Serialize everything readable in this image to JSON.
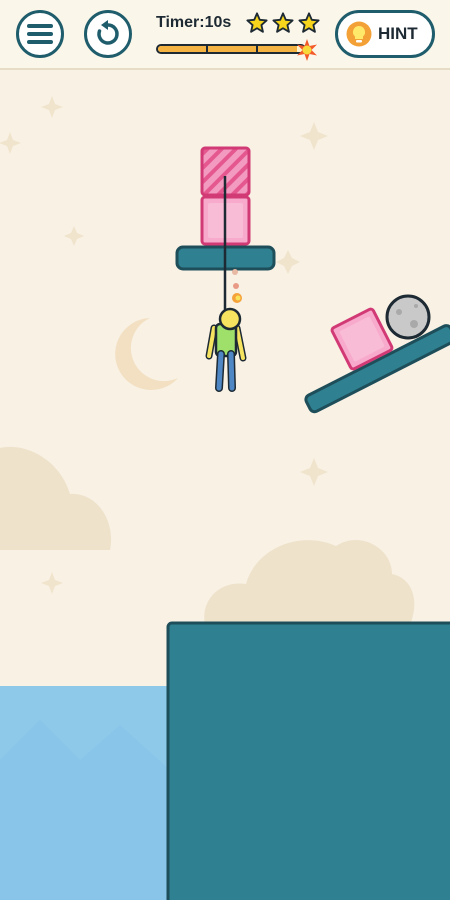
{
  "toolbar": {
    "menu_icon": "hamburger-menu-icon",
    "restart_icon": "restart-icon",
    "hint_label": "HINT",
    "hint_icon": "lightbulb-icon"
  },
  "timer": {
    "label": "Timer:10s",
    "stars_earned": 3,
    "stars_total": 3,
    "progress": 0.95
  },
  "colors": {
    "accent": "#1f5d6c",
    "teal_platform": "#2f8090",
    "pink_block": "#f4a8c6",
    "pink_outline": "#d9457f",
    "water": "#8ec9ea",
    "star": "#f7d51d"
  }
}
